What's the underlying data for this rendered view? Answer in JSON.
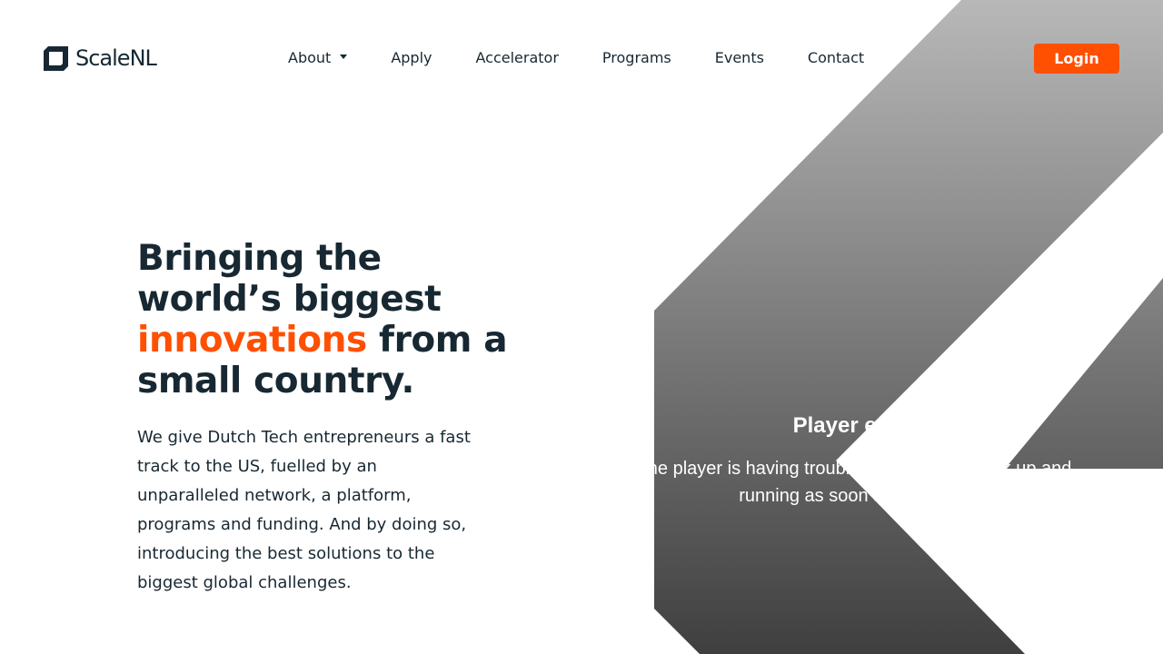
{
  "brand": {
    "name": "ScaleNL",
    "logo_icon": "scalenl-logo-mark",
    "colors": {
      "accent": "#ff4f00",
      "text": "#172832",
      "white": "#ffffff"
    }
  },
  "nav": {
    "items": [
      {
        "label": "About",
        "has_dropdown": true
      },
      {
        "label": "Apply"
      },
      {
        "label": "Accelerator"
      },
      {
        "label": "Programs"
      },
      {
        "label": "Events"
      },
      {
        "label": "Contact"
      }
    ],
    "login_label": "Login"
  },
  "hero": {
    "title_before": "Bringing the world’s biggest ",
    "title_accent": "innovations",
    "title_after": " from a small country.",
    "description": "We give Dutch Tech entrepreneurs a fast track to the US, fuelled by an unparalleled network, a platform, programs and funding. And by doing so, introducing the best solutions to the biggest global challenges."
  },
  "player": {
    "error_title": "Player error",
    "error_message": "The player is having trouble. We’ll have it back up and running as soon as possible."
  }
}
